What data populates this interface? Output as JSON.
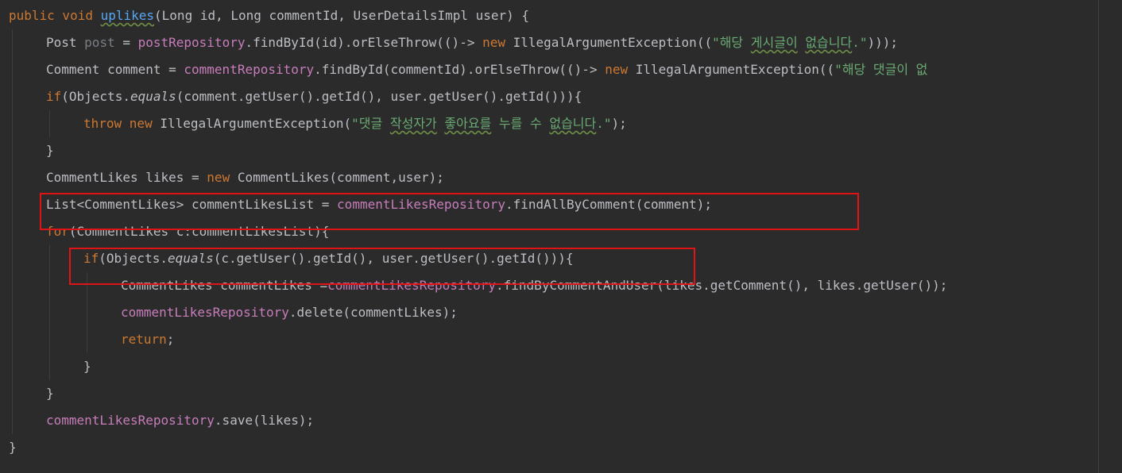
{
  "editor": {
    "lines": [
      {
        "indent": 0,
        "tokens": [
          {
            "t": "public void ",
            "c": "kw"
          },
          {
            "t": "uplikes",
            "c": "fn typo"
          },
          {
            "t": "(Long id, Long commentId, UserDetailsImpl user) {",
            "c": "plain"
          }
        ]
      },
      {
        "indent": 1,
        "tokens": [
          {
            "t": "Post ",
            "c": "plain"
          },
          {
            "t": "post",
            "c": "unused"
          },
          {
            "t": " = ",
            "c": "plain"
          },
          {
            "t": "postRepository",
            "c": "fld"
          },
          {
            "t": ".findById(id).orElseThrow(()-> ",
            "c": "plain"
          },
          {
            "t": "new ",
            "c": "kw"
          },
          {
            "t": "IllegalArgumentException((",
            "c": "plain"
          },
          {
            "t": "\"해당 ",
            "c": "str"
          },
          {
            "t": "게시글이",
            "c": "str typo"
          },
          {
            "t": " ",
            "c": "str"
          },
          {
            "t": "없습니다",
            "c": "str typo"
          },
          {
            "t": ".\"",
            "c": "str"
          },
          {
            "t": ")));",
            "c": "plain"
          }
        ]
      },
      {
        "indent": 1,
        "tokens": [
          {
            "t": "Comment comment = ",
            "c": "plain"
          },
          {
            "t": "commentRepository",
            "c": "fld"
          },
          {
            "t": ".findById(commentId).orElseThrow(()-> ",
            "c": "plain"
          },
          {
            "t": "new ",
            "c": "kw"
          },
          {
            "t": "IllegalArgumentException((",
            "c": "plain"
          },
          {
            "t": "\"해당 댓글이 없",
            "c": "str"
          }
        ]
      },
      {
        "indent": 1,
        "tokens": [
          {
            "t": "if",
            "c": "kw"
          },
          {
            "t": "(Objects.",
            "c": "plain"
          },
          {
            "t": "equals",
            "c": "plain ital"
          },
          {
            "t": "(comment.getUser().getId(), user.getUser().getId())){",
            "c": "plain"
          }
        ]
      },
      {
        "indent": 2,
        "tokens": [
          {
            "t": "throw new ",
            "c": "kw"
          },
          {
            "t": "IllegalArgumentException(",
            "c": "plain"
          },
          {
            "t": "\"댓글 ",
            "c": "str"
          },
          {
            "t": "작성자가",
            "c": "str typo"
          },
          {
            "t": " ",
            "c": "str"
          },
          {
            "t": "좋아요를",
            "c": "str typo"
          },
          {
            "t": " 누를 수 ",
            "c": "str"
          },
          {
            "t": "없습니다",
            "c": "str typo"
          },
          {
            "t": ".\"",
            "c": "str"
          },
          {
            "t": ");",
            "c": "plain"
          }
        ]
      },
      {
        "indent": 1,
        "tokens": [
          {
            "t": "}",
            "c": "plain"
          }
        ]
      },
      {
        "indent": 1,
        "tokens": [
          {
            "t": "CommentLikes likes = ",
            "c": "plain"
          },
          {
            "t": "new ",
            "c": "kw"
          },
          {
            "t": "CommentLikes(comment,user);",
            "c": "plain"
          }
        ]
      },
      {
        "indent": 1,
        "tokens": [
          {
            "t": "List<CommentLikes> commentLikesList = ",
            "c": "plain"
          },
          {
            "t": "commentLikesRepository",
            "c": "fld"
          },
          {
            "t": ".findAllByComment(comment);",
            "c": "plain"
          }
        ]
      },
      {
        "indent": 1,
        "tokens": [
          {
            "t": "for",
            "c": "kw"
          },
          {
            "t": "(CommentLikes c:commentLikesList){",
            "c": "plain"
          }
        ]
      },
      {
        "indent": 2,
        "tokens": [
          {
            "t": "if",
            "c": "kw"
          },
          {
            "t": "(Objects.",
            "c": "plain"
          },
          {
            "t": "equals",
            "c": "plain ital"
          },
          {
            "t": "(c.getUser().getId(), user.getUser().getId())){",
            "c": "plain"
          }
        ]
      },
      {
        "indent": 3,
        "tokens": [
          {
            "t": "CommentLikes commentLikes =",
            "c": "plain"
          },
          {
            "t": "commentLikesRepository",
            "c": "fld"
          },
          {
            "t": ".findByCommentAndUser(likes.getComment(), likes.getUser());",
            "c": "plain"
          }
        ]
      },
      {
        "indent": 3,
        "tokens": [
          {
            "t": "commentLikesRepository",
            "c": "fld"
          },
          {
            "t": ".delete(commentLikes);",
            "c": "plain"
          }
        ]
      },
      {
        "indent": 3,
        "tokens": [
          {
            "t": "return",
            "c": "kw"
          },
          {
            "t": ";",
            "c": "plain"
          }
        ]
      },
      {
        "indent": 2,
        "tokens": [
          {
            "t": "}",
            "c": "plain"
          }
        ]
      },
      {
        "indent": 1,
        "tokens": [
          {
            "t": "}",
            "c": "plain"
          }
        ]
      },
      {
        "indent": 1,
        "tokens": [
          {
            "t": "commentLikesRepository",
            "c": "fld"
          },
          {
            "t": ".save(likes);",
            "c": "plain"
          }
        ]
      },
      {
        "indent": 0,
        "tokens": [
          {
            "t": "}",
            "c": "plain"
          }
        ]
      }
    ],
    "highlighted_lines": [
      7,
      9
    ],
    "colors": {
      "background": "#2b2b2b",
      "keyword": "#cc7832",
      "identifier": "#bcbec4",
      "field": "#c77dbb",
      "string": "#6aab73",
      "method_name": "#56a8f5",
      "unused_variable": "#7a7e85",
      "highlight_box": "#e01414"
    }
  }
}
